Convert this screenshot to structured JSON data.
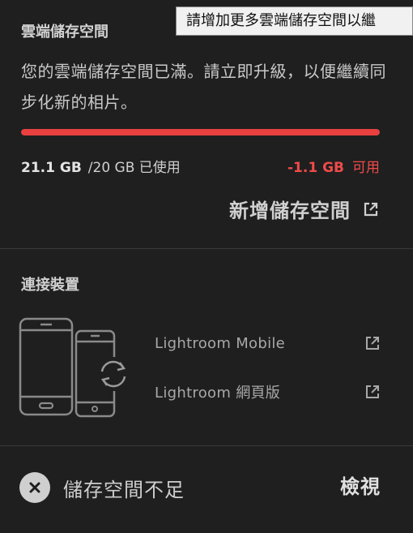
{
  "storage": {
    "title": "雲端儲存空間",
    "message": "您的雲端儲存空間已滿。請立即升級，以便繼續同步化新的相片。",
    "used": "21.1 GB",
    "total": "/20 GB 已使用",
    "available_amount": "-1.1 GB",
    "available_label": "可用",
    "usage_progress_percent": 100,
    "add_storage_label": "新增儲存空間"
  },
  "tooltip": {
    "text": "請增加更多雲端儲存空間以繼"
  },
  "devices": {
    "title": "連接裝置",
    "links": [
      {
        "label": "Lightroom Mobile"
      },
      {
        "label": "Lightroom 網頁版"
      }
    ]
  },
  "footer": {
    "status_text": "儲存空間不足",
    "view_label": "檢視"
  },
  "colors": {
    "background": "#1f1f1f",
    "accent_red": "#e8403f",
    "text": "#d6d6d6"
  },
  "icons": [
    "external-link-icon",
    "devices-sync-icon",
    "close-circle-icon"
  ]
}
